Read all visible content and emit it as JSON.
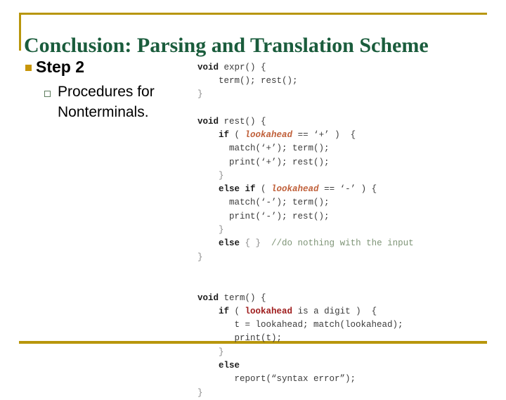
{
  "slide": {
    "title": "Conclusion: Parsing and Translation Scheme",
    "accent_gold": "#b8960c",
    "title_color": "#1a5c3c",
    "bullet_marker_color": "#c8960a"
  },
  "bullets": [
    {
      "level": 1,
      "label": "Step 2"
    },
    {
      "level": 2,
      "label": "Procedures for Nonterminals."
    }
  ],
  "code": {
    "language": "c",
    "lines": [
      {
        "id": "l1",
        "indent": 0,
        "segments": [
          {
            "t": "void ",
            "k": "kw"
          },
          {
            "t": "expr() {",
            "k": "plain"
          }
        ]
      },
      {
        "id": "l2",
        "indent": 0,
        "segments": [
          {
            "t": "    term(); rest();",
            "k": "plain"
          }
        ]
      },
      {
        "id": "l3",
        "indent": 0,
        "segments": [
          {
            "t": "}",
            "k": "brace"
          }
        ]
      },
      {
        "id": "l4",
        "indent": 0,
        "segments": [
          {
            "t": " ",
            "k": "plain"
          }
        ]
      },
      {
        "id": "l5",
        "indent": 0,
        "segments": [
          {
            "t": "void ",
            "k": "kw"
          },
          {
            "t": "rest() {",
            "k": "plain"
          }
        ]
      },
      {
        "id": "l6",
        "indent": 0,
        "segments": [
          {
            "t": "    ",
            "k": "plain"
          },
          {
            "t": "if",
            "k": "kw"
          },
          {
            "t": " ( ",
            "k": "plain"
          },
          {
            "t": "lookahead",
            "k": "la-italic"
          },
          {
            "t": " == ‘+’ )  {",
            "k": "plain"
          }
        ]
      },
      {
        "id": "l7",
        "indent": 0,
        "segments": [
          {
            "t": "      match(‘+’); term();",
            "k": "plain"
          }
        ]
      },
      {
        "id": "l8",
        "indent": 0,
        "segments": [
          {
            "t": "      print(‘+’); rest();",
            "k": "plain"
          }
        ]
      },
      {
        "id": "l9",
        "indent": 0,
        "segments": [
          {
            "t": "    }",
            "k": "brace"
          }
        ]
      },
      {
        "id": "l10",
        "indent": 0,
        "segments": [
          {
            "t": "    ",
            "k": "plain"
          },
          {
            "t": "else if",
            "k": "kw"
          },
          {
            "t": " ( ",
            "k": "plain"
          },
          {
            "t": "lookahead",
            "k": "la-italic"
          },
          {
            "t": " == ‘-’ ) {",
            "k": "plain"
          }
        ]
      },
      {
        "id": "l11",
        "indent": 0,
        "segments": [
          {
            "t": "      match(‘-’); term();",
            "k": "plain"
          }
        ]
      },
      {
        "id": "l12",
        "indent": 0,
        "segments": [
          {
            "t": "      print(‘-’); rest();",
            "k": "plain"
          }
        ]
      },
      {
        "id": "l13",
        "indent": 0,
        "segments": [
          {
            "t": "    }",
            "k": "brace"
          }
        ]
      },
      {
        "id": "l14",
        "indent": 0,
        "segments": [
          {
            "t": "    ",
            "k": "plain"
          },
          {
            "t": "else",
            "k": "kw"
          },
          {
            "t": " { }  ",
            "k": "brace"
          },
          {
            "t": "//do nothing with the input",
            "k": "cmt"
          }
        ]
      },
      {
        "id": "l15",
        "indent": 0,
        "segments": [
          {
            "t": "}",
            "k": "brace"
          }
        ]
      },
      {
        "id": "l16",
        "indent": 0,
        "segments": [
          {
            "t": " ",
            "k": "plain"
          }
        ]
      },
      {
        "id": "l17",
        "indent": 0,
        "segments": [
          {
            "t": " ",
            "k": "plain"
          }
        ]
      },
      {
        "id": "l18",
        "indent": 0,
        "segments": [
          {
            "t": "void ",
            "k": "kw"
          },
          {
            "t": "term() {",
            "k": "plain"
          }
        ]
      },
      {
        "id": "l19",
        "indent": 0,
        "segments": [
          {
            "t": "    ",
            "k": "plain"
          },
          {
            "t": "if",
            "k": "kw"
          },
          {
            "t": " ( ",
            "k": "plain"
          },
          {
            "t": "lookahead",
            "k": "la-red"
          },
          {
            "t": " is a digit )  {",
            "k": "plain"
          }
        ]
      },
      {
        "id": "l20",
        "indent": 0,
        "segments": [
          {
            "t": "       t = lookahead; match(lookahead);",
            "k": "plain"
          }
        ]
      },
      {
        "id": "l21",
        "indent": 0,
        "segments": [
          {
            "t": "       print(t);",
            "k": "plain"
          }
        ]
      },
      {
        "id": "l22",
        "indent": 0,
        "segments": [
          {
            "t": "    }",
            "k": "brace"
          }
        ]
      },
      {
        "id": "l23",
        "indent": 0,
        "segments": [
          {
            "t": "    ",
            "k": "plain"
          },
          {
            "t": "else",
            "k": "kw"
          }
        ]
      },
      {
        "id": "l24",
        "indent": 0,
        "segments": [
          {
            "t": "       report(“syntax error”);",
            "k": "plain"
          }
        ]
      },
      {
        "id": "l25",
        "indent": 0,
        "segments": [
          {
            "t": "}",
            "k": "brace"
          }
        ]
      }
    ]
  }
}
